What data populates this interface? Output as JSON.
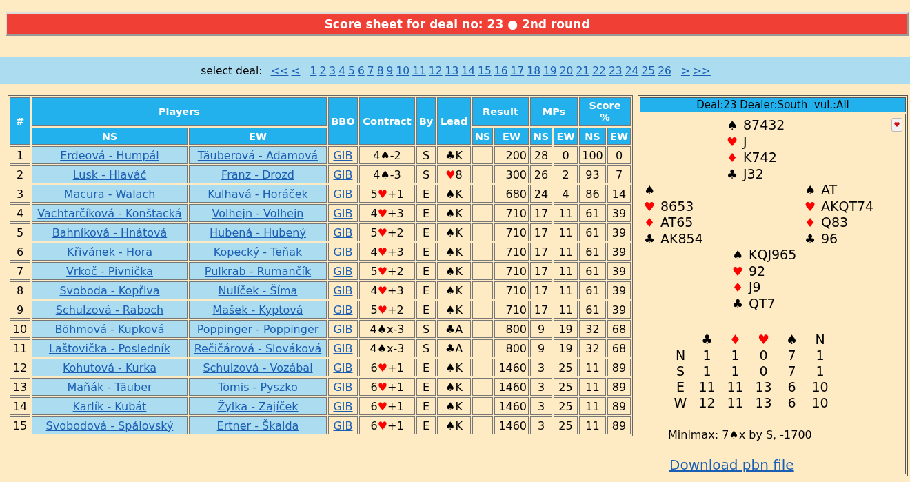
{
  "title": "Score sheet for deal no: 23 ● 2nd round",
  "deal_nav": {
    "label": "select deal:",
    "links": [
      "<<",
      "<",
      "1",
      "2",
      "3",
      "4",
      "5",
      "6",
      "7",
      "8",
      "9",
      "10",
      "11",
      "12",
      "13",
      "14",
      "15",
      "16",
      "17",
      "18",
      "19",
      "20",
      "21",
      "22",
      "23",
      "24",
      "25",
      "26",
      ">",
      ">>"
    ]
  },
  "table": {
    "headers": {
      "number": "#",
      "players": "Players",
      "sub": [
        "NS",
        "EW",
        "NS",
        "EW",
        "NS",
        "EW",
        "NS",
        "EW"
      ],
      "bbo": "BBO",
      "contract": "Contract",
      "by": "By",
      "lead": "Lead",
      "result": "Result",
      "mps": "MPs",
      "score": "Score %"
    },
    "rows": [
      {
        "no": "1",
        "ns": "Erdeová - Humpál",
        "ew": "Täuberová - Adamová",
        "bbo": "GIB",
        "contract": {
          "level": "4",
          "suit": "♠",
          "red": false,
          "tail": "-2"
        },
        "by": "S",
        "lead": {
          "suit": "♣",
          "red": false,
          "card": "K"
        },
        "result_ew": "200",
        "mp_ns": "28",
        "mp_ew": "0",
        "score_ns": "100",
        "score_ew": "0"
      },
      {
        "no": "2",
        "ns": "Lusk - Hlaváč",
        "ew": "Franz - Drozd",
        "bbo": "GIB",
        "contract": {
          "level": "4",
          "suit": "♠",
          "red": false,
          "tail": "-3"
        },
        "by": "S",
        "lead": {
          "suit": "♥",
          "red": true,
          "card": "8"
        },
        "result_ew": "300",
        "mp_ns": "26",
        "mp_ew": "2",
        "score_ns": "93",
        "score_ew": "7"
      },
      {
        "no": "3",
        "ns": "Macura - Walach",
        "ew": "Kulhavá - Horáček",
        "bbo": "GIB",
        "contract": {
          "level": "5",
          "suit": "♥",
          "red": true,
          "tail": "+1"
        },
        "by": "E",
        "lead": {
          "suit": "♠",
          "red": false,
          "card": "K"
        },
        "result_ew": "680",
        "mp_ns": "24",
        "mp_ew": "4",
        "score_ns": "86",
        "score_ew": "14"
      },
      {
        "no": "4",
        "ns": "Vachtarčíková - Konštacká",
        "ew": "Volhejn - Volhejn",
        "bbo": "GIB",
        "contract": {
          "level": "4",
          "suit": "♥",
          "red": true,
          "tail": "+3"
        },
        "by": "E",
        "lead": {
          "suit": "♠",
          "red": false,
          "card": "K"
        },
        "result_ew": "710",
        "mp_ns": "17",
        "mp_ew": "11",
        "score_ns": "61",
        "score_ew": "39"
      },
      {
        "no": "5",
        "ns": "Bahníková - Hnátová",
        "ew": "Hubená - Hubený",
        "bbo": "GIB",
        "contract": {
          "level": "5",
          "suit": "♥",
          "red": true,
          "tail": "+2"
        },
        "by": "E",
        "lead": {
          "suit": "♠",
          "red": false,
          "card": "K"
        },
        "result_ew": "710",
        "mp_ns": "17",
        "mp_ew": "11",
        "score_ns": "61",
        "score_ew": "39"
      },
      {
        "no": "6",
        "ns": "Křivánek - Hora",
        "ew": "Kopecký - Teňak",
        "bbo": "GIB",
        "contract": {
          "level": "4",
          "suit": "♥",
          "red": true,
          "tail": "+3"
        },
        "by": "E",
        "lead": {
          "suit": "♠",
          "red": false,
          "card": "K"
        },
        "result_ew": "710",
        "mp_ns": "17",
        "mp_ew": "11",
        "score_ns": "61",
        "score_ew": "39"
      },
      {
        "no": "7",
        "ns": "Vrkoč - Pivnička",
        "ew": "Pulkrab - Rumančík",
        "bbo": "GIB",
        "contract": {
          "level": "5",
          "suit": "♥",
          "red": true,
          "tail": "+2"
        },
        "by": "E",
        "lead": {
          "suit": "♠",
          "red": false,
          "card": "K"
        },
        "result_ew": "710",
        "mp_ns": "17",
        "mp_ew": "11",
        "score_ns": "61",
        "score_ew": "39"
      },
      {
        "no": "8",
        "ns": "Svoboda - Kopřiva",
        "ew": "Nulíček - Šíma",
        "bbo": "GIB",
        "contract": {
          "level": "4",
          "suit": "♥",
          "red": true,
          "tail": "+3"
        },
        "by": "E",
        "lead": {
          "suit": "♠",
          "red": false,
          "card": "K"
        },
        "result_ew": "710",
        "mp_ns": "17",
        "mp_ew": "11",
        "score_ns": "61",
        "score_ew": "39"
      },
      {
        "no": "9",
        "ns": "Schulzová - Raboch",
        "ew": "Mašek - Kyptová",
        "bbo": "GIB",
        "contract": {
          "level": "5",
          "suit": "♥",
          "red": true,
          "tail": "+2"
        },
        "by": "E",
        "lead": {
          "suit": "♠",
          "red": false,
          "card": "K"
        },
        "result_ew": "710",
        "mp_ns": "17",
        "mp_ew": "11",
        "score_ns": "61",
        "score_ew": "39"
      },
      {
        "no": "10",
        "ns": "Böhmová - Kupková",
        "ew": "Poppinger - Poppinger",
        "bbo": "GIB",
        "contract": {
          "level": "4",
          "suit": "♠",
          "red": false,
          "tail": "x-3"
        },
        "by": "S",
        "lead": {
          "suit": "♣",
          "red": false,
          "card": "A"
        },
        "result_ew": "800",
        "mp_ns": "9",
        "mp_ew": "19",
        "score_ns": "32",
        "score_ew": "68"
      },
      {
        "no": "11",
        "ns": "Laštovička - Posledník",
        "ew": "Rečičárová - Slováková",
        "bbo": "GIB",
        "contract": {
          "level": "4",
          "suit": "♠",
          "red": false,
          "tail": "x-3"
        },
        "by": "S",
        "lead": {
          "suit": "♣",
          "red": false,
          "card": "A"
        },
        "result_ew": "800",
        "mp_ns": "9",
        "mp_ew": "19",
        "score_ns": "32",
        "score_ew": "68"
      },
      {
        "no": "12",
        "ns": "Kohutová - Kurka",
        "ew": "Schulzová - Vozábal",
        "bbo": "GIB",
        "contract": {
          "level": "6",
          "suit": "♥",
          "red": true,
          "tail": "+1"
        },
        "by": "E",
        "lead": {
          "suit": "♠",
          "red": false,
          "card": "K"
        },
        "result_ew": "1460",
        "mp_ns": "3",
        "mp_ew": "25",
        "score_ns": "11",
        "score_ew": "89"
      },
      {
        "no": "13",
        "ns": "Maňák - Täuber",
        "ew": "Tomis - Pyszko",
        "bbo": "GIB",
        "contract": {
          "level": "6",
          "suit": "♥",
          "red": true,
          "tail": "+1"
        },
        "by": "E",
        "lead": {
          "suit": "♠",
          "red": false,
          "card": "K"
        },
        "result_ew": "1460",
        "mp_ns": "3",
        "mp_ew": "25",
        "score_ns": "11",
        "score_ew": "89"
      },
      {
        "no": "14",
        "ns": "Karlík - Kubát",
        "ew": "Žylka - Zajíček",
        "bbo": "GIB",
        "contract": {
          "level": "6",
          "suit": "♥",
          "red": true,
          "tail": "+1"
        },
        "by": "E",
        "lead": {
          "suit": "♠",
          "red": false,
          "card": "K"
        },
        "result_ew": "1460",
        "mp_ns": "3",
        "mp_ew": "25",
        "score_ns": "11",
        "score_ew": "89"
      },
      {
        "no": "15",
        "ns": "Svobodová - Spálovský",
        "ew": "Ertner - Škalda",
        "bbo": "GIB",
        "contract": {
          "level": "6",
          "suit": "♥",
          "red": true,
          "tail": "+1"
        },
        "by": "E",
        "lead": {
          "suit": "♠",
          "red": false,
          "card": "K"
        },
        "result_ew": "1460",
        "mp_ns": "3",
        "mp_ew": "25",
        "score_ns": "11",
        "score_ew": "89"
      }
    ]
  },
  "deal": {
    "header": "Deal:23 Dealer:South  vul.:All",
    "north": [
      {
        "suit": "♠",
        "red": false,
        "cards": "87432"
      },
      {
        "suit": "♥",
        "red": true,
        "cards": "J"
      },
      {
        "suit": "♦",
        "red": true,
        "cards": "K742"
      },
      {
        "suit": "♣",
        "red": false,
        "cards": "J32"
      }
    ],
    "west": [
      {
        "suit": "♠",
        "red": false
      },
      {
        "suit": "♥",
        "red": true,
        "cards": "8653"
      },
      {
        "suit": "♦",
        "red": true,
        "cards": "AT65"
      },
      {
        "suit": "♣",
        "red": false,
        "cards": "AK854"
      }
    ],
    "east": [
      {
        "suit": "♠",
        "red": false,
        "cards": "AT"
      },
      {
        "suit": "♥",
        "red": true,
        "cards": "AKQT74"
      },
      {
        "suit": "♦",
        "red": true,
        "cards": "Q83"
      },
      {
        "suit": "♣",
        "red": false,
        "cards": "96"
      }
    ],
    "south": [
      {
        "suit": "♠",
        "red": false,
        "cards": "KQJ965"
      },
      {
        "suit": "♥",
        "red": true,
        "cards": "92"
      },
      {
        "suit": "♦",
        "red": true,
        "cards": "J9"
      },
      {
        "suit": "♣",
        "red": false,
        "cards": "QT7"
      }
    ],
    "dd_header": [
      {
        "symbol": "♣",
        "red": false
      },
      {
        "symbol": "♦",
        "red": true
      },
      {
        "symbol": "♥",
        "red": true
      },
      {
        "symbol": "♠",
        "red": false
      },
      {
        "symbol": "N",
        "red": false
      }
    ],
    "dd_rows": [
      {
        "seat": "N",
        "tricks": [
          "1",
          "1",
          "0",
          "7",
          "1"
        ]
      },
      {
        "seat": "S",
        "tricks": [
          "1",
          "1",
          "0",
          "7",
          "1"
        ]
      },
      {
        "seat": "E",
        "tricks": [
          "11",
          "11",
          "13",
          "6",
          "10"
        ]
      },
      {
        "seat": "W",
        "tricks": [
          "12",
          "11",
          "13",
          "6",
          "10"
        ]
      }
    ],
    "minimax": "Minimax: 7♠x by S, -1700",
    "download": "Download pbn file"
  }
}
